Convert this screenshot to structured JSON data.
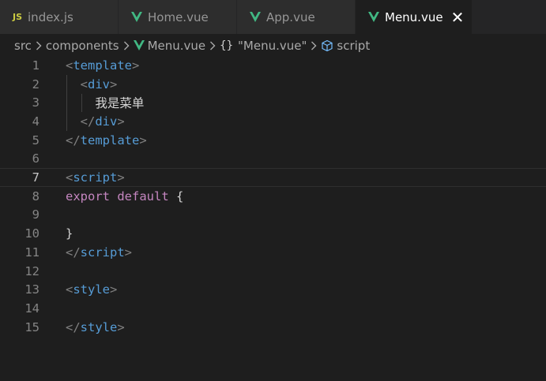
{
  "tabs": [
    {
      "label": "index.js",
      "icon": "js-icon",
      "active": false
    },
    {
      "label": "Home.vue",
      "icon": "vue-icon",
      "active": false
    },
    {
      "label": "App.vue",
      "icon": "vue-icon",
      "active": false
    },
    {
      "label": "Menu.vue",
      "icon": "vue-icon",
      "active": true,
      "close": "✕"
    }
  ],
  "breadcrumb": {
    "items": [
      "src",
      "components",
      "Menu.vue",
      "\"Menu.vue\"",
      "script"
    ],
    "braces": "{}"
  },
  "editor": {
    "current_line": 7,
    "lines": [
      {
        "n": "1",
        "parts": [
          [
            "tagb",
            "<"
          ],
          [
            "tagn",
            "template"
          ],
          [
            "tagb",
            ">"
          ]
        ]
      },
      {
        "n": "2",
        "parts": [
          [
            "txt",
            "  "
          ],
          [
            "tagb",
            "<"
          ],
          [
            "tagn",
            "div"
          ],
          [
            "tagb",
            ">"
          ]
        ]
      },
      {
        "n": "3",
        "parts": [
          [
            "txt",
            "    我是菜单"
          ]
        ]
      },
      {
        "n": "4",
        "parts": [
          [
            "txt",
            "  "
          ],
          [
            "tagb",
            "</"
          ],
          [
            "tagn",
            "div"
          ],
          [
            "tagb",
            ">"
          ]
        ]
      },
      {
        "n": "5",
        "parts": [
          [
            "tagb",
            "</"
          ],
          [
            "tagn",
            "template"
          ],
          [
            "tagb",
            ">"
          ]
        ]
      },
      {
        "n": "6",
        "parts": []
      },
      {
        "n": "7",
        "parts": [
          [
            "tagb",
            "<"
          ],
          [
            "tagn",
            "script"
          ],
          [
            "tagb",
            ">"
          ]
        ]
      },
      {
        "n": "8",
        "parts": [
          [
            "kw",
            "export"
          ],
          [
            "txt",
            " "
          ],
          [
            "kw",
            "default"
          ],
          [
            "txt",
            " {"
          ]
        ]
      },
      {
        "n": "9",
        "parts": []
      },
      {
        "n": "10",
        "parts": [
          [
            "txt",
            "}"
          ]
        ]
      },
      {
        "n": "11",
        "parts": [
          [
            "tagb",
            "</"
          ],
          [
            "tagn",
            "script"
          ],
          [
            "tagb",
            ">"
          ]
        ]
      },
      {
        "n": "12",
        "parts": []
      },
      {
        "n": "13",
        "parts": [
          [
            "tagb",
            "<"
          ],
          [
            "tagn",
            "style"
          ],
          [
            "tagb",
            ">"
          ]
        ]
      },
      {
        "n": "14",
        "parts": []
      },
      {
        "n": "15",
        "parts": [
          [
            "tagb",
            "</"
          ],
          [
            "tagn",
            "style"
          ],
          [
            "tagb",
            ">"
          ]
        ]
      }
    ]
  },
  "colors": {
    "background": "#1e1e1e",
    "tag_bracket": "#808080",
    "tag_name": "#569cd6",
    "keyword": "#c586c0",
    "text": "#d4d4d4",
    "vue_green": "#41b883",
    "js_yellow": "#cbcb41"
  }
}
